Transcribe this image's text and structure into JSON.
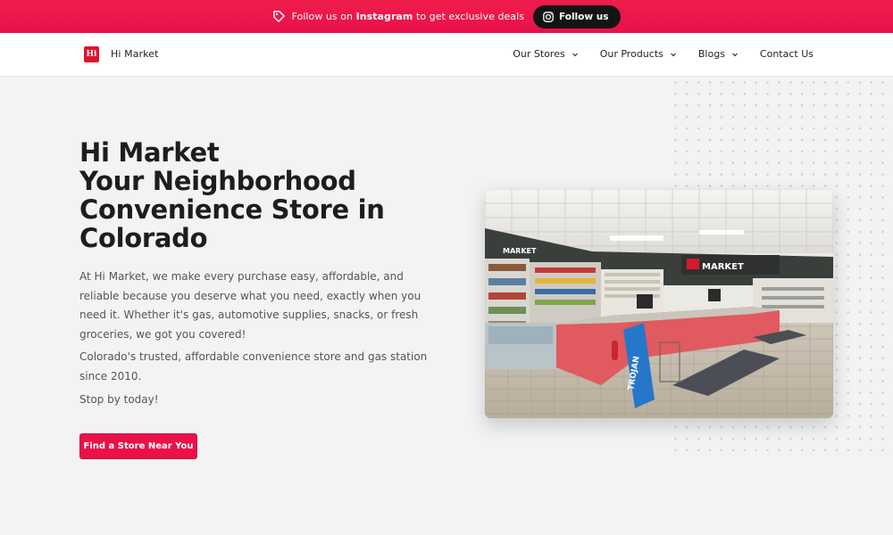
{
  "promo": {
    "text_prefix": "Follow us on ",
    "text_bold": "Instagram",
    "text_suffix": " to get exclusive deals",
    "tag_icon": "tag-icon",
    "button_label": "Follow us",
    "button_icon": "instagram-icon",
    "bg_color": "#e8114a"
  },
  "header": {
    "brand": "Hi Market",
    "logo_text": "Hi",
    "nav": [
      {
        "label": "Our Stores",
        "has_dropdown": true
      },
      {
        "label": "Our Products",
        "has_dropdown": true
      },
      {
        "label": "Blogs",
        "has_dropdown": true
      },
      {
        "label": "Contact Us",
        "has_dropdown": false
      }
    ]
  },
  "hero": {
    "title_lines": [
      "Hi Market",
      "Your Neighborhood",
      "Convenience Store in",
      "Colorado"
    ],
    "paragraph1": "At Hi Market, we make every purchase easy, affordable, and reliable because you deserve what you need, exactly when you need it. Whether it's gas, automotive supplies, snacks, or fresh groceries, we got you covered!",
    "paragraph2": "Colorado's trusted, affordable convenience store and gas station since 2010.",
    "paragraph3": "Stop by today!",
    "cta_label": "Find a Store Near You",
    "image_sign_1": "MARKET",
    "image_sign_2": "MARKET"
  },
  "colors": {
    "accent": "#e8114a",
    "dark": "#141414",
    "text": "#1d1d1d"
  }
}
